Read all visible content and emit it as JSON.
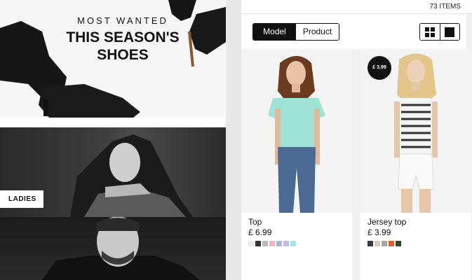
{
  "hero": {
    "subtitle": "MOST WANTED",
    "title_line1": "THIS SEASON'S",
    "title_line2": "SHOES"
  },
  "categories": {
    "ladies": "LADIES"
  },
  "listing": {
    "item_count": "73 ITEMS",
    "view_toggle": {
      "model": "Model",
      "product": "Product",
      "selected": "Model"
    },
    "grid_mode": "grid"
  },
  "products": [
    {
      "name": "Top",
      "price": "£ 6.99",
      "badge": "",
      "swatches": [
        "#e9e9ee",
        "#333333",
        "#b9b9c2",
        "#f2b4c7",
        "#a9b8df",
        "#c8b8e6",
        "#9fe7e1"
      ]
    },
    {
      "name": "Jersey top",
      "price": "£ 3.99",
      "badge": "£ 3.99",
      "swatches": [
        "#3a3a3a",
        "#d8cbb7",
        "#a8a8a8",
        "#e85d24",
        "#2f4a2e"
      ]
    }
  ]
}
